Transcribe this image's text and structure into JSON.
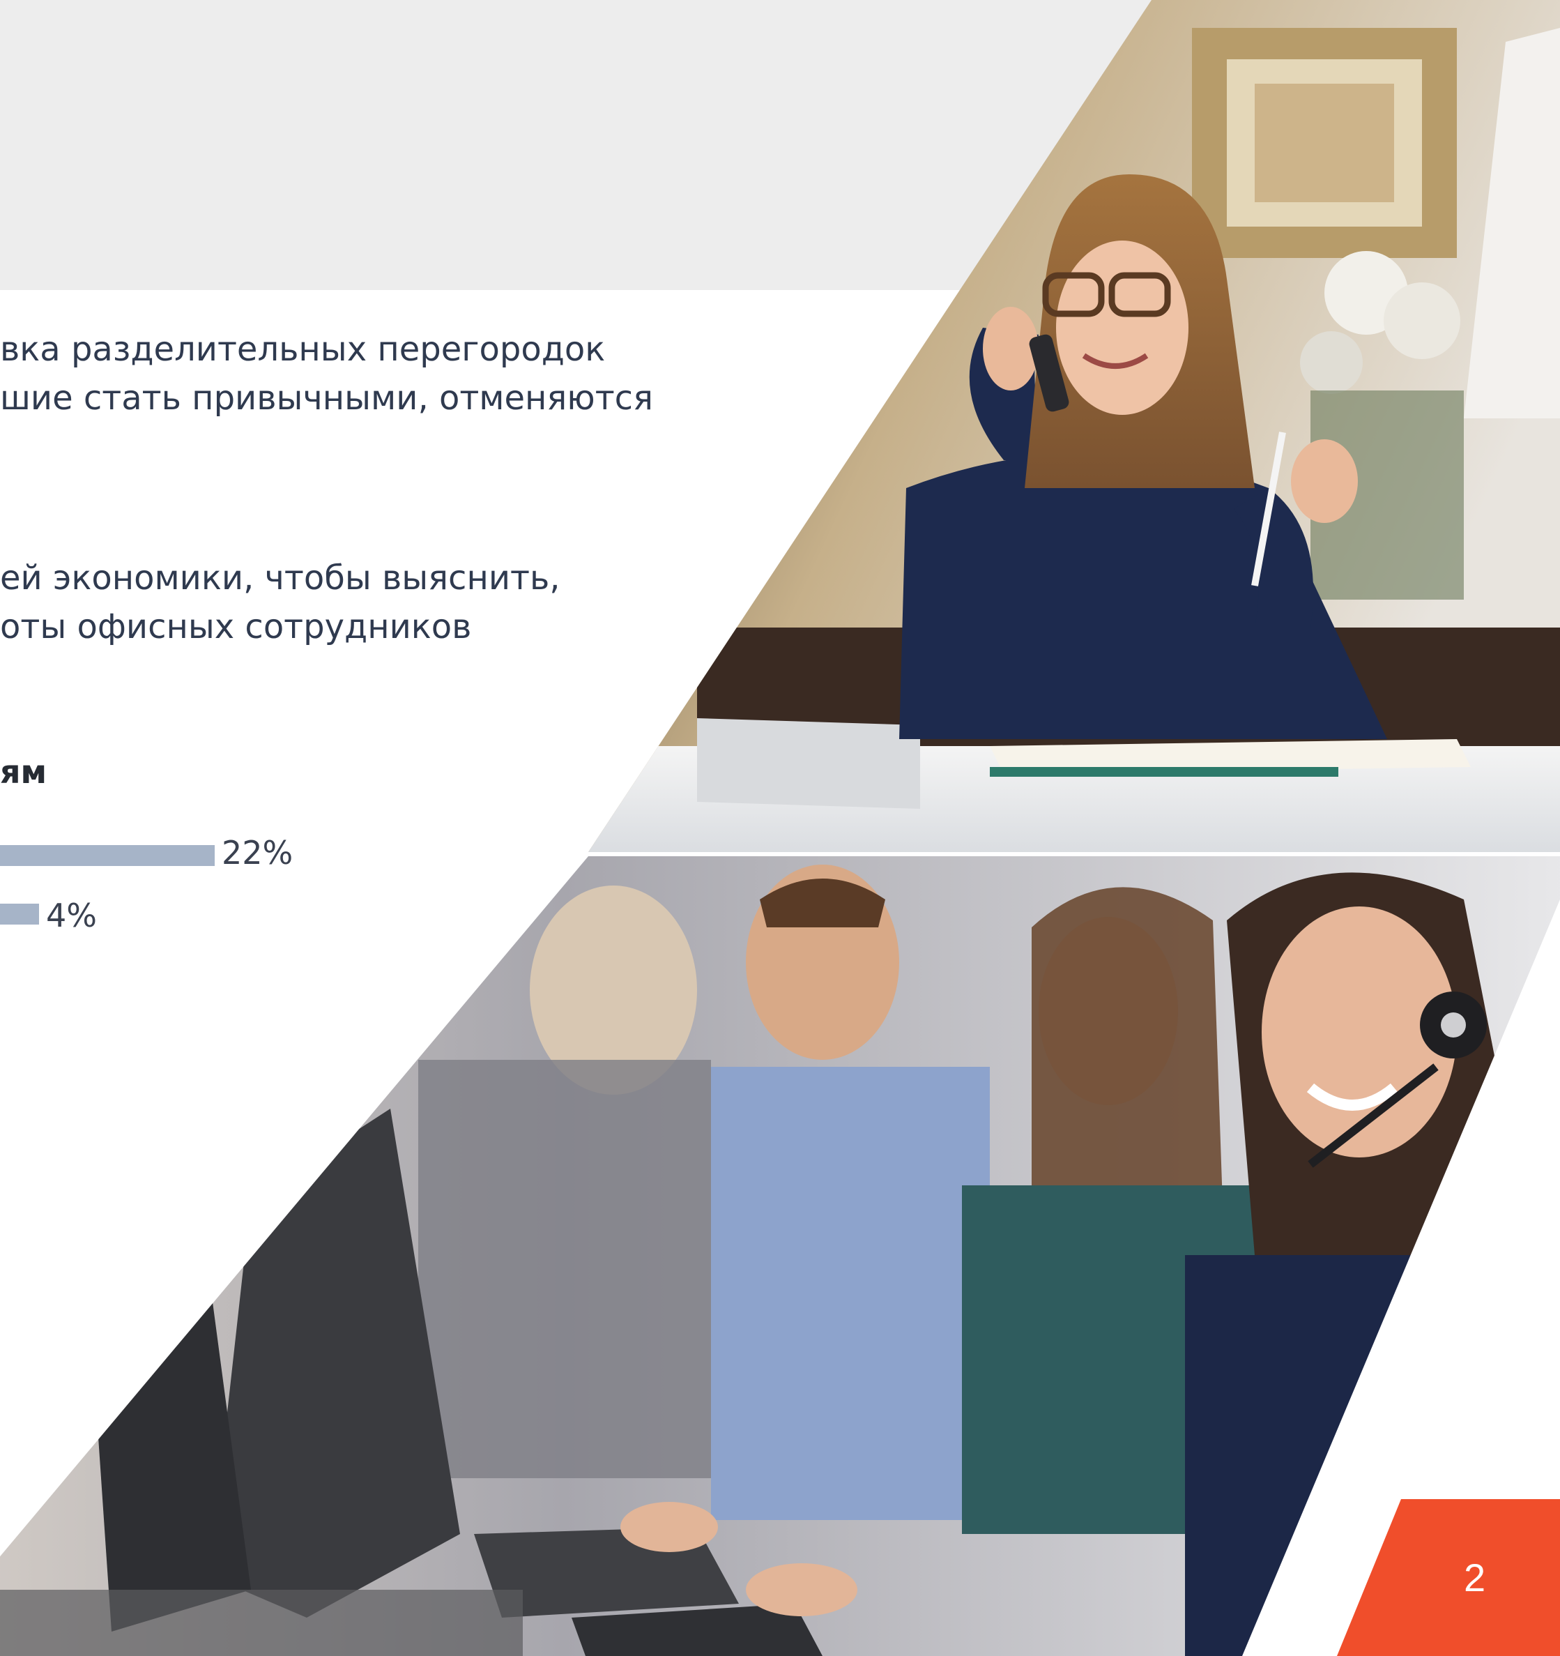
{
  "text": {
    "paragraph_1": [
      "вка разделительных перегородок",
      "шие стать привычными, отменяются"
    ],
    "paragraph_2": [
      "ей экономики, чтобы выяснить,",
      "оты офисных сотрудников"
    ],
    "chart_subtitle": "ям"
  },
  "chart_data": {
    "type": "bar",
    "orientation": "horizontal",
    "values": [
      22,
      4
    ],
    "value_labels": [
      "22%",
      "4%"
    ]
  },
  "page_number": "2",
  "images": {
    "top_photo": "woman-on-phone-photo",
    "bottom_photo": "call-center-operators-photo"
  },
  "colors": {
    "top_band": "#ededed",
    "text": "#2f3a4f",
    "bar": "#a6b4c8",
    "accent": "#f04e2b"
  }
}
